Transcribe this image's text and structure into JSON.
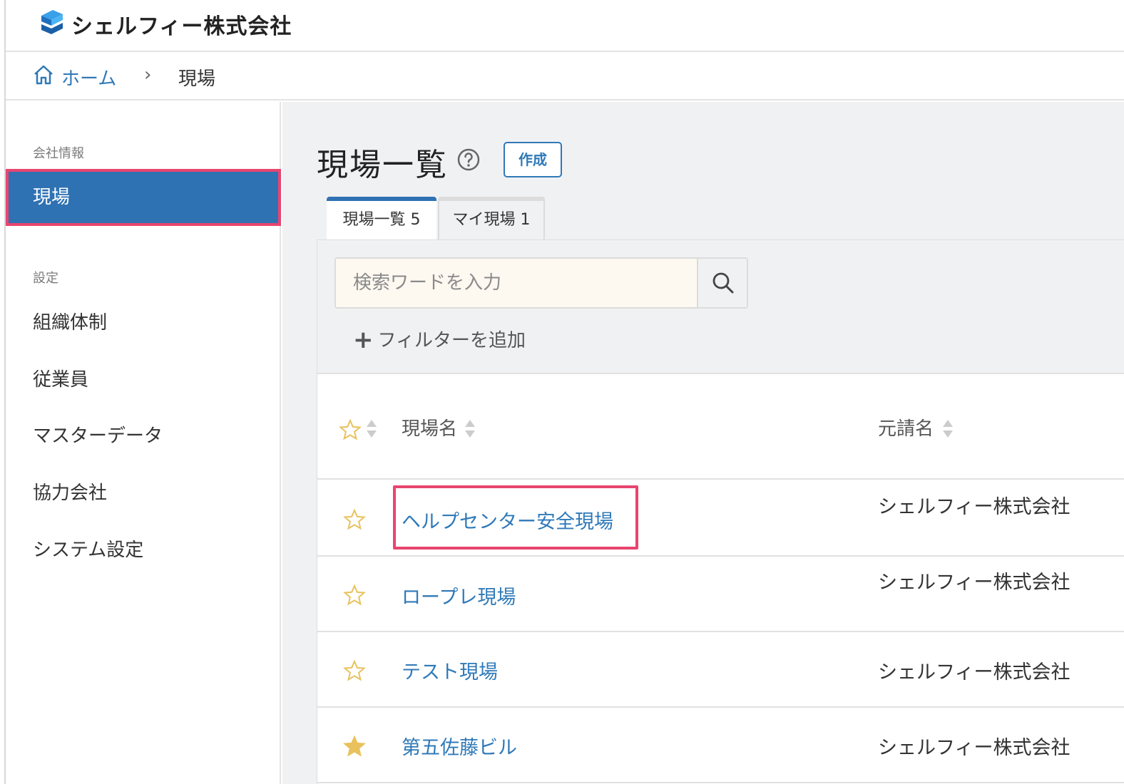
{
  "header": {
    "company_name": "シェルフィー株式会社",
    "logo_icon": "shelfy-logo-icon"
  },
  "breadcrumb": {
    "home_icon": "home-icon",
    "home_label": "ホーム",
    "separator": "›",
    "current": "現場"
  },
  "sidebar": {
    "section_company": "会社情報",
    "active_item": "現場",
    "section_settings": "設定",
    "items": [
      "組織体制",
      "従業員",
      "マスターデータ",
      "協力会社",
      "システム設定"
    ]
  },
  "main": {
    "title": "現場一覧",
    "help_icon": "help-circle-icon",
    "create_label": "作成",
    "tabs": [
      {
        "label": "現場一覧 5"
      },
      {
        "label": "マイ現場 1"
      }
    ],
    "search": {
      "placeholder": "検索ワードを入力",
      "icon": "search-icon"
    },
    "add_filter_label": "フィルターを追加",
    "table": {
      "columns": {
        "name": "現場名",
        "contractor": "元請名"
      },
      "rows": [
        {
          "name": "ヘルプセンター安全現場",
          "contractor": "シェルフィー株式会社",
          "starred": false
        },
        {
          "name": "ロープレ現場",
          "contractor": "シェルフィー株式会社",
          "starred": false
        },
        {
          "name": "テスト現場",
          "contractor": "シェルフィー株式会社",
          "starred": false
        },
        {
          "name": "第五佐藤ビル",
          "contractor": "シェルフィー株式会社",
          "starred": true
        }
      ]
    }
  },
  "colors": {
    "accent": "#2f72b3",
    "link": "#2f79b8",
    "highlight": "#e8456f",
    "star": "#e9c25e"
  }
}
